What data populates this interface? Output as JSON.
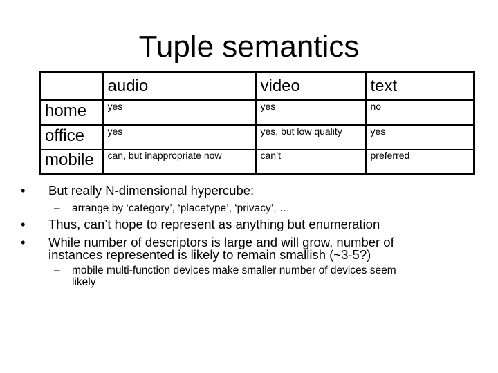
{
  "slide": {
    "title": "Tuple semantics",
    "table": {
      "columns": [
        "",
        "audio",
        "video",
        "text"
      ],
      "rows": [
        {
          "label": "home",
          "cells": [
            "yes",
            "yes",
            "no"
          ]
        },
        {
          "label": "office",
          "cells": [
            "yes",
            "yes, but low quality",
            "yes"
          ]
        },
        {
          "label": "mobile",
          "cells": [
            "can, but inappropriate now",
            "can’t",
            "preferred"
          ]
        }
      ]
    },
    "bullets": [
      {
        "marker": "•",
        "text": "But really N-dimensional hypercube:",
        "sub": [
          {
            "marker": "–",
            "text": "arrange by ‘category’, ‘placetype’, ‘privacy’, …"
          }
        ]
      },
      {
        "marker": "•",
        "text": "Thus, can’t hope to represent as anything but enumeration"
      },
      {
        "marker": "•",
        "text_line1": "While number of descriptors is large and will grow, number of",
        "text_line2": "instances represented is likely to remain smallish (~3-5?)",
        "sub": [
          {
            "marker": "–",
            "text_line1": "mobile multi-function devices make smaller number of devices seem",
            "text_line2": "likely"
          }
        ]
      }
    ]
  }
}
